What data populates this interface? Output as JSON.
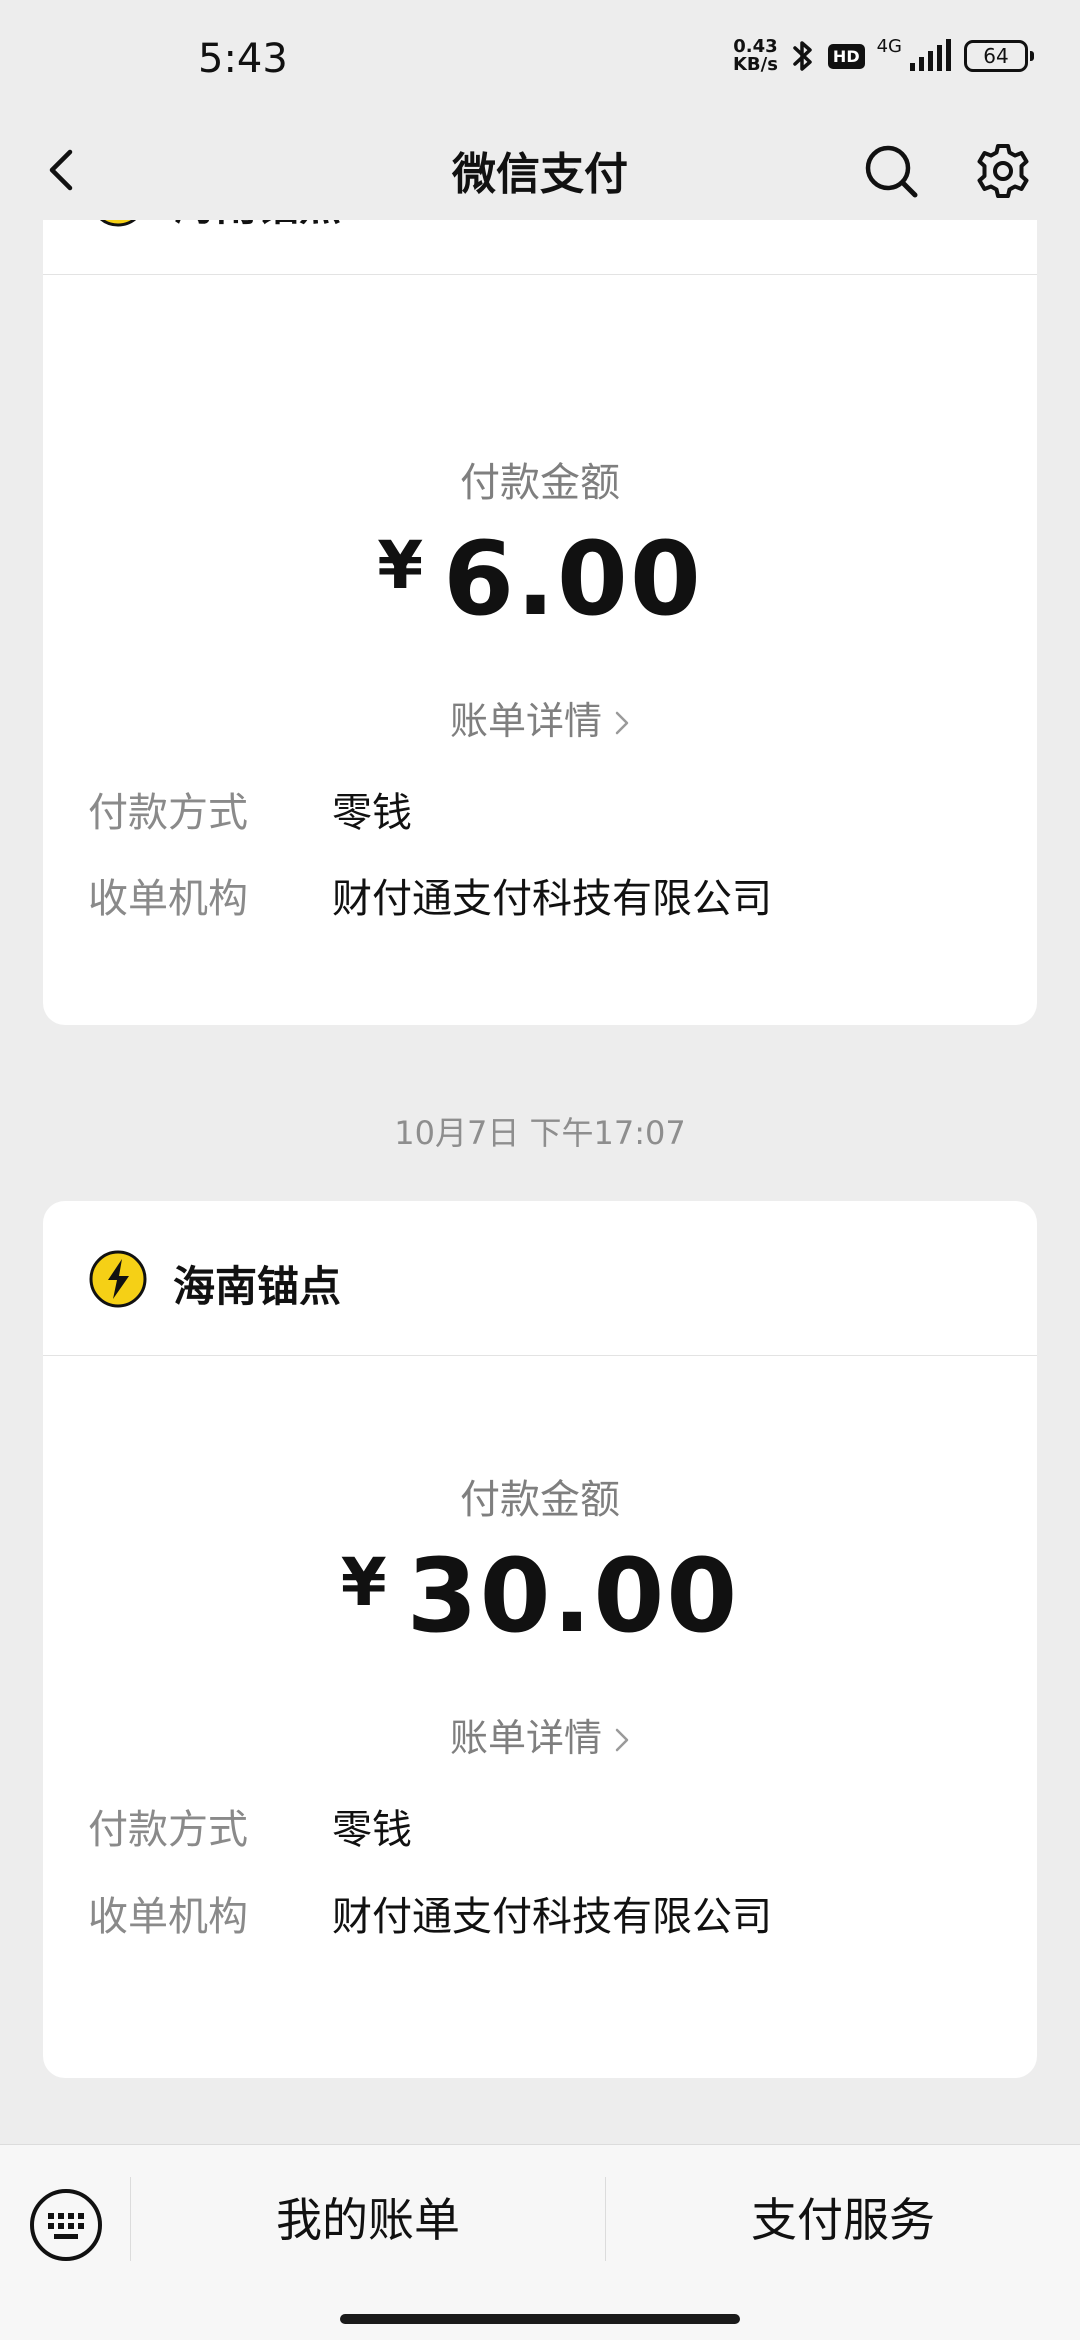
{
  "status_bar": {
    "time": "5:43",
    "net_speed_value": "0.43",
    "net_speed_unit": "KB/s",
    "hd": "HD",
    "network": "4G",
    "battery": "64"
  },
  "nav": {
    "title": "微信支付",
    "back_icon": "back-arrow-icon",
    "search_icon": "search-icon",
    "settings_icon": "gear-icon"
  },
  "payments": [
    {
      "merchant": "海南锚点",
      "amount_label": "付款金额",
      "currency": "¥",
      "amount": "6.00",
      "detail_link": "账单详情",
      "method_label": "付款方式",
      "method_value": "零钱",
      "acquirer_label": "收单机构",
      "acquirer_value": "财付通支付科技有限公司"
    },
    {
      "merchant": "海南锚点",
      "amount_label": "付款金额",
      "currency": "¥",
      "amount": "30.00",
      "detail_link": "账单详情",
      "method_label": "付款方式",
      "method_value": "零钱",
      "acquirer_label": "收单机构",
      "acquirer_value": "财付通支付科技有限公司"
    }
  ],
  "date_separator": "10月7日 下午17:07",
  "bottom_bar": {
    "keyboard_icon": "keyboard-icon",
    "tab_bills": "我的账单",
    "tab_services": "支付服务"
  },
  "colors": {
    "background": "#ededed",
    "card": "#ffffff",
    "secondary_text": "#7f7f7f",
    "merchant_logo": "#f5d016"
  }
}
